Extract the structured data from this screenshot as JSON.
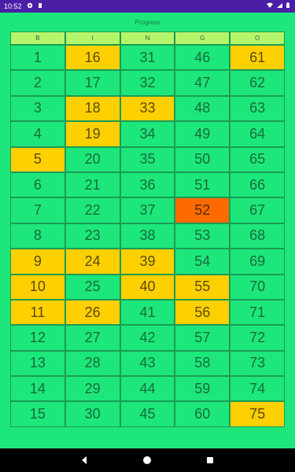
{
  "status_bar": {
    "time": "10:52"
  },
  "app": {
    "title": "Progress"
  },
  "columns": [
    "B",
    "I",
    "N",
    "G",
    "O"
  ],
  "grid": [
    [
      {
        "n": "1",
        "s": ""
      },
      {
        "n": "16",
        "s": "called"
      },
      {
        "n": "31",
        "s": ""
      },
      {
        "n": "46",
        "s": ""
      },
      {
        "n": "61",
        "s": "called"
      }
    ],
    [
      {
        "n": "2",
        "s": ""
      },
      {
        "n": "17",
        "s": ""
      },
      {
        "n": "32",
        "s": ""
      },
      {
        "n": "47",
        "s": ""
      },
      {
        "n": "62",
        "s": ""
      }
    ],
    [
      {
        "n": "3",
        "s": ""
      },
      {
        "n": "18",
        "s": "called"
      },
      {
        "n": "33",
        "s": "called"
      },
      {
        "n": "48",
        "s": ""
      },
      {
        "n": "63",
        "s": ""
      }
    ],
    [
      {
        "n": "4",
        "s": ""
      },
      {
        "n": "19",
        "s": "called"
      },
      {
        "n": "34",
        "s": ""
      },
      {
        "n": "49",
        "s": ""
      },
      {
        "n": "64",
        "s": ""
      }
    ],
    [
      {
        "n": "5",
        "s": "called"
      },
      {
        "n": "20",
        "s": ""
      },
      {
        "n": "35",
        "s": ""
      },
      {
        "n": "50",
        "s": ""
      },
      {
        "n": "65",
        "s": ""
      }
    ],
    [
      {
        "n": "6",
        "s": ""
      },
      {
        "n": "21",
        "s": ""
      },
      {
        "n": "36",
        "s": ""
      },
      {
        "n": "51",
        "s": ""
      },
      {
        "n": "66",
        "s": ""
      }
    ],
    [
      {
        "n": "7",
        "s": ""
      },
      {
        "n": "22",
        "s": ""
      },
      {
        "n": "37",
        "s": ""
      },
      {
        "n": "52",
        "s": "current"
      },
      {
        "n": "67",
        "s": ""
      }
    ],
    [
      {
        "n": "8",
        "s": ""
      },
      {
        "n": "23",
        "s": ""
      },
      {
        "n": "38",
        "s": ""
      },
      {
        "n": "53",
        "s": ""
      },
      {
        "n": "68",
        "s": ""
      }
    ],
    [
      {
        "n": "9",
        "s": "called"
      },
      {
        "n": "24",
        "s": "called"
      },
      {
        "n": "39",
        "s": "called"
      },
      {
        "n": "54",
        "s": ""
      },
      {
        "n": "69",
        "s": ""
      }
    ],
    [
      {
        "n": "10",
        "s": "called"
      },
      {
        "n": "25",
        "s": ""
      },
      {
        "n": "40",
        "s": "called"
      },
      {
        "n": "55",
        "s": "called"
      },
      {
        "n": "70",
        "s": ""
      }
    ],
    [
      {
        "n": "11",
        "s": "called"
      },
      {
        "n": "26",
        "s": "called"
      },
      {
        "n": "41",
        "s": ""
      },
      {
        "n": "56",
        "s": "called"
      },
      {
        "n": "71",
        "s": ""
      }
    ],
    [
      {
        "n": "12",
        "s": ""
      },
      {
        "n": "27",
        "s": ""
      },
      {
        "n": "42",
        "s": ""
      },
      {
        "n": "57",
        "s": ""
      },
      {
        "n": "72",
        "s": ""
      }
    ],
    [
      {
        "n": "13",
        "s": ""
      },
      {
        "n": "28",
        "s": ""
      },
      {
        "n": "43",
        "s": ""
      },
      {
        "n": "58",
        "s": ""
      },
      {
        "n": "73",
        "s": ""
      }
    ],
    [
      {
        "n": "14",
        "s": ""
      },
      {
        "n": "29",
        "s": ""
      },
      {
        "n": "44",
        "s": ""
      },
      {
        "n": "59",
        "s": ""
      },
      {
        "n": "74",
        "s": ""
      }
    ],
    [
      {
        "n": "15",
        "s": ""
      },
      {
        "n": "30",
        "s": ""
      },
      {
        "n": "45",
        "s": ""
      },
      {
        "n": "60",
        "s": ""
      },
      {
        "n": "75",
        "s": "called"
      }
    ]
  ],
  "colors": {
    "background": "#1de77b",
    "status_bar": "#4a1fa6",
    "header_cell": "#b5f56a",
    "called": "#ffd000",
    "current": "#ff6a00",
    "grid_line": "#1b9b53"
  },
  "icons": {
    "status_left": [
      "pin-icon",
      "sd-card-icon"
    ],
    "status_right": [
      "wifi-icon",
      "signal-icon",
      "battery-icon"
    ],
    "nav": [
      "back-icon",
      "home-icon",
      "recent-apps-icon"
    ]
  }
}
